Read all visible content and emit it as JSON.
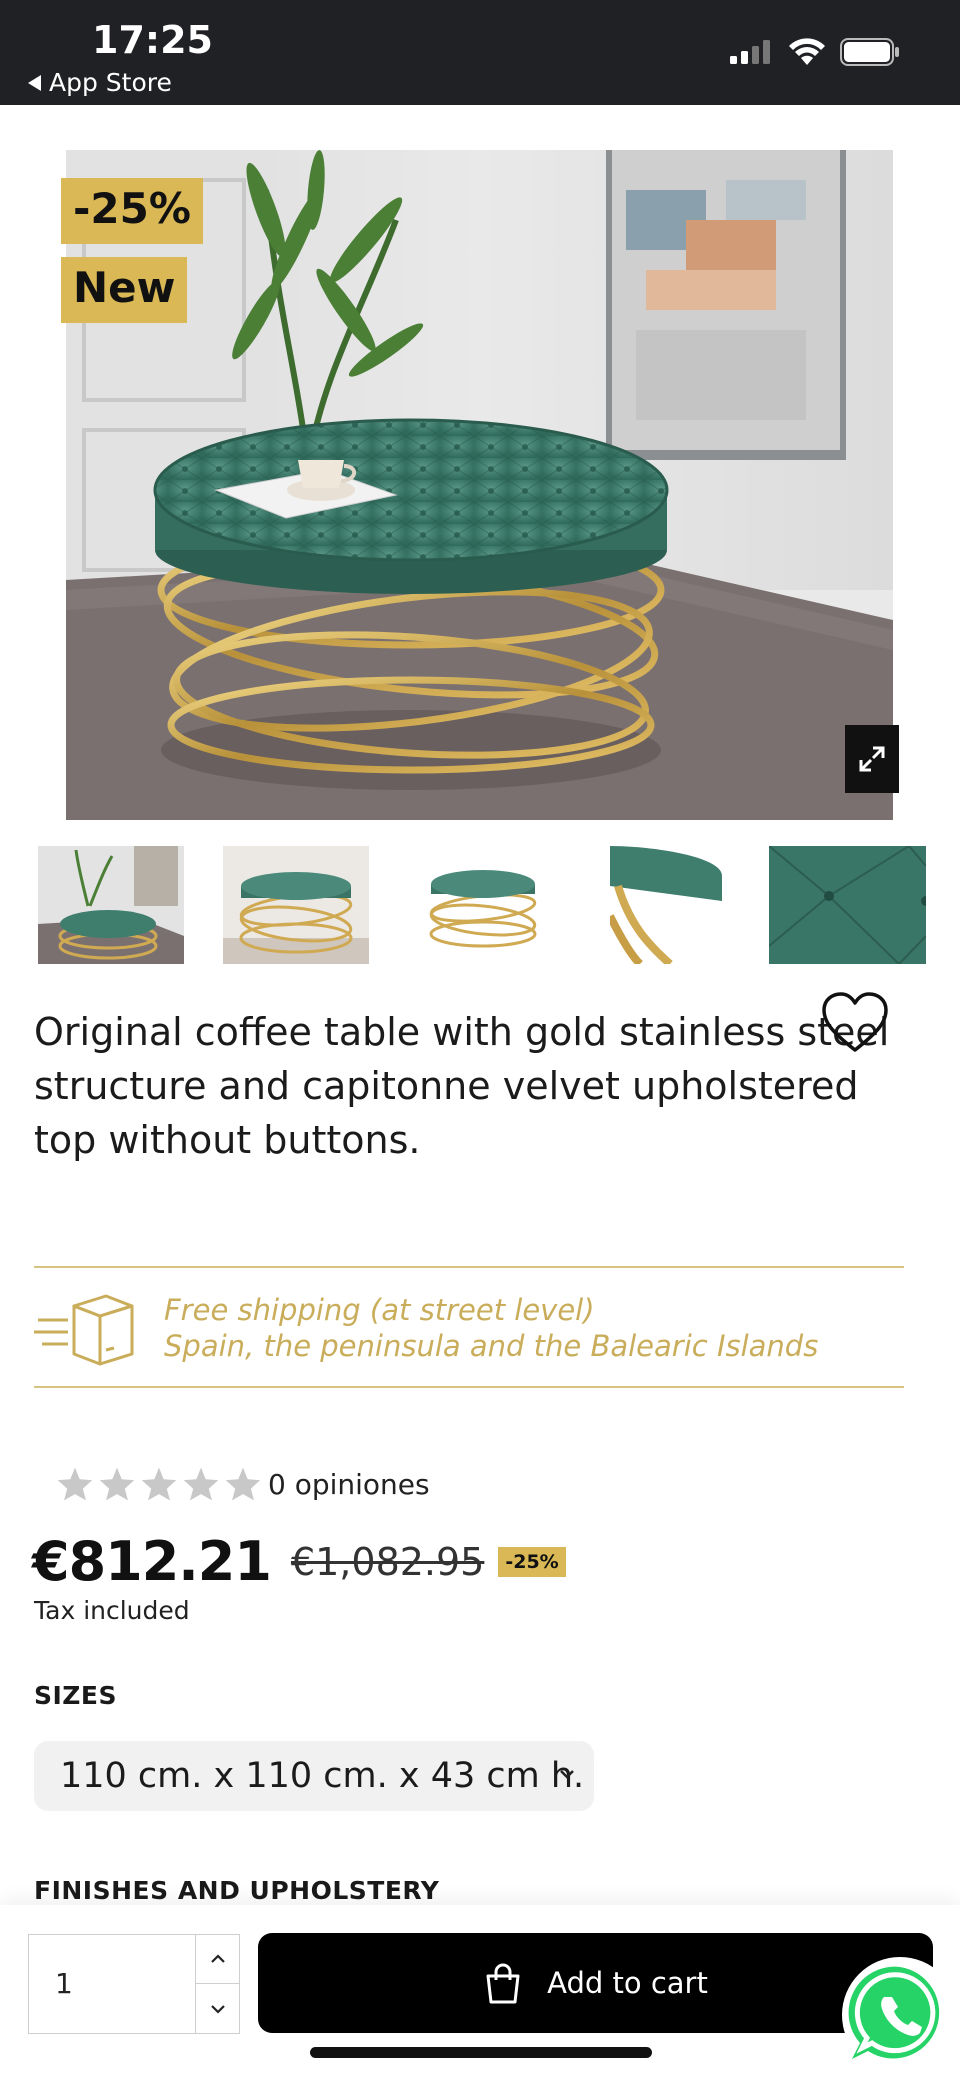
{
  "status_bar": {
    "time": "17:25",
    "back_label": "App Store",
    "icons": [
      "signal-icon",
      "wifi-icon",
      "battery-icon"
    ]
  },
  "product": {
    "badges": [
      "-25%",
      "New"
    ],
    "thumbnail_count": 5,
    "description": "Original coffee table with gold stainless steel structure and capitonne velvet upholstered top without buttons.",
    "shipping": {
      "line1": "Free shipping (at street level)",
      "line2": "Spain, the peninsula and the Balearic Islands"
    },
    "rating": {
      "stars": 0,
      "max_stars": 5,
      "text": "0 opiniones"
    },
    "price": {
      "current": "€812.21",
      "old": "€1,082.95",
      "discount": "-25%",
      "tax_note": "Tax included"
    },
    "sizes_label": "SIZES",
    "size_selected": "110 cm. x 110 cm. x 43 cm h.",
    "finishes_label": "FINISHES AND UPHOLSTERY"
  },
  "cart": {
    "quantity": "1",
    "add_label": "Add to cart"
  },
  "colors": {
    "accent_gold": "#d9b855",
    "shipping_text": "#c9ad5a",
    "velvet_green": "#3f7d6d",
    "button_black": "#000000",
    "whatsapp_green": "#25d366"
  }
}
